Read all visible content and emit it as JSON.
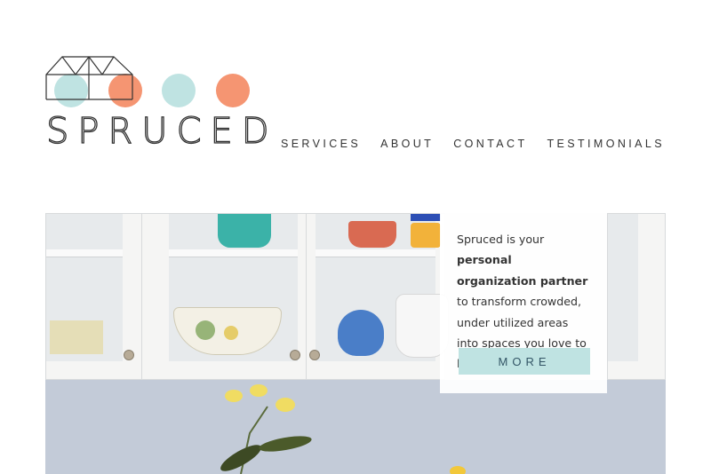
{
  "brand": {
    "name": "SPRUCED"
  },
  "nav": [
    {
      "label": "SERVICES"
    },
    {
      "label": "ABOUT"
    },
    {
      "label": "CONTACT"
    },
    {
      "label": "TESTIMONIALS"
    }
  ],
  "hero": {
    "intro": "Spruced is your ",
    "highlight": "personal organization partner",
    "rest": " to transform crowded, under utilized areas into spaces you love to live.",
    "button_label": "MORE"
  },
  "colors": {
    "teal": "#bfe3e2",
    "coral": "#f59572",
    "text": "#333333"
  }
}
